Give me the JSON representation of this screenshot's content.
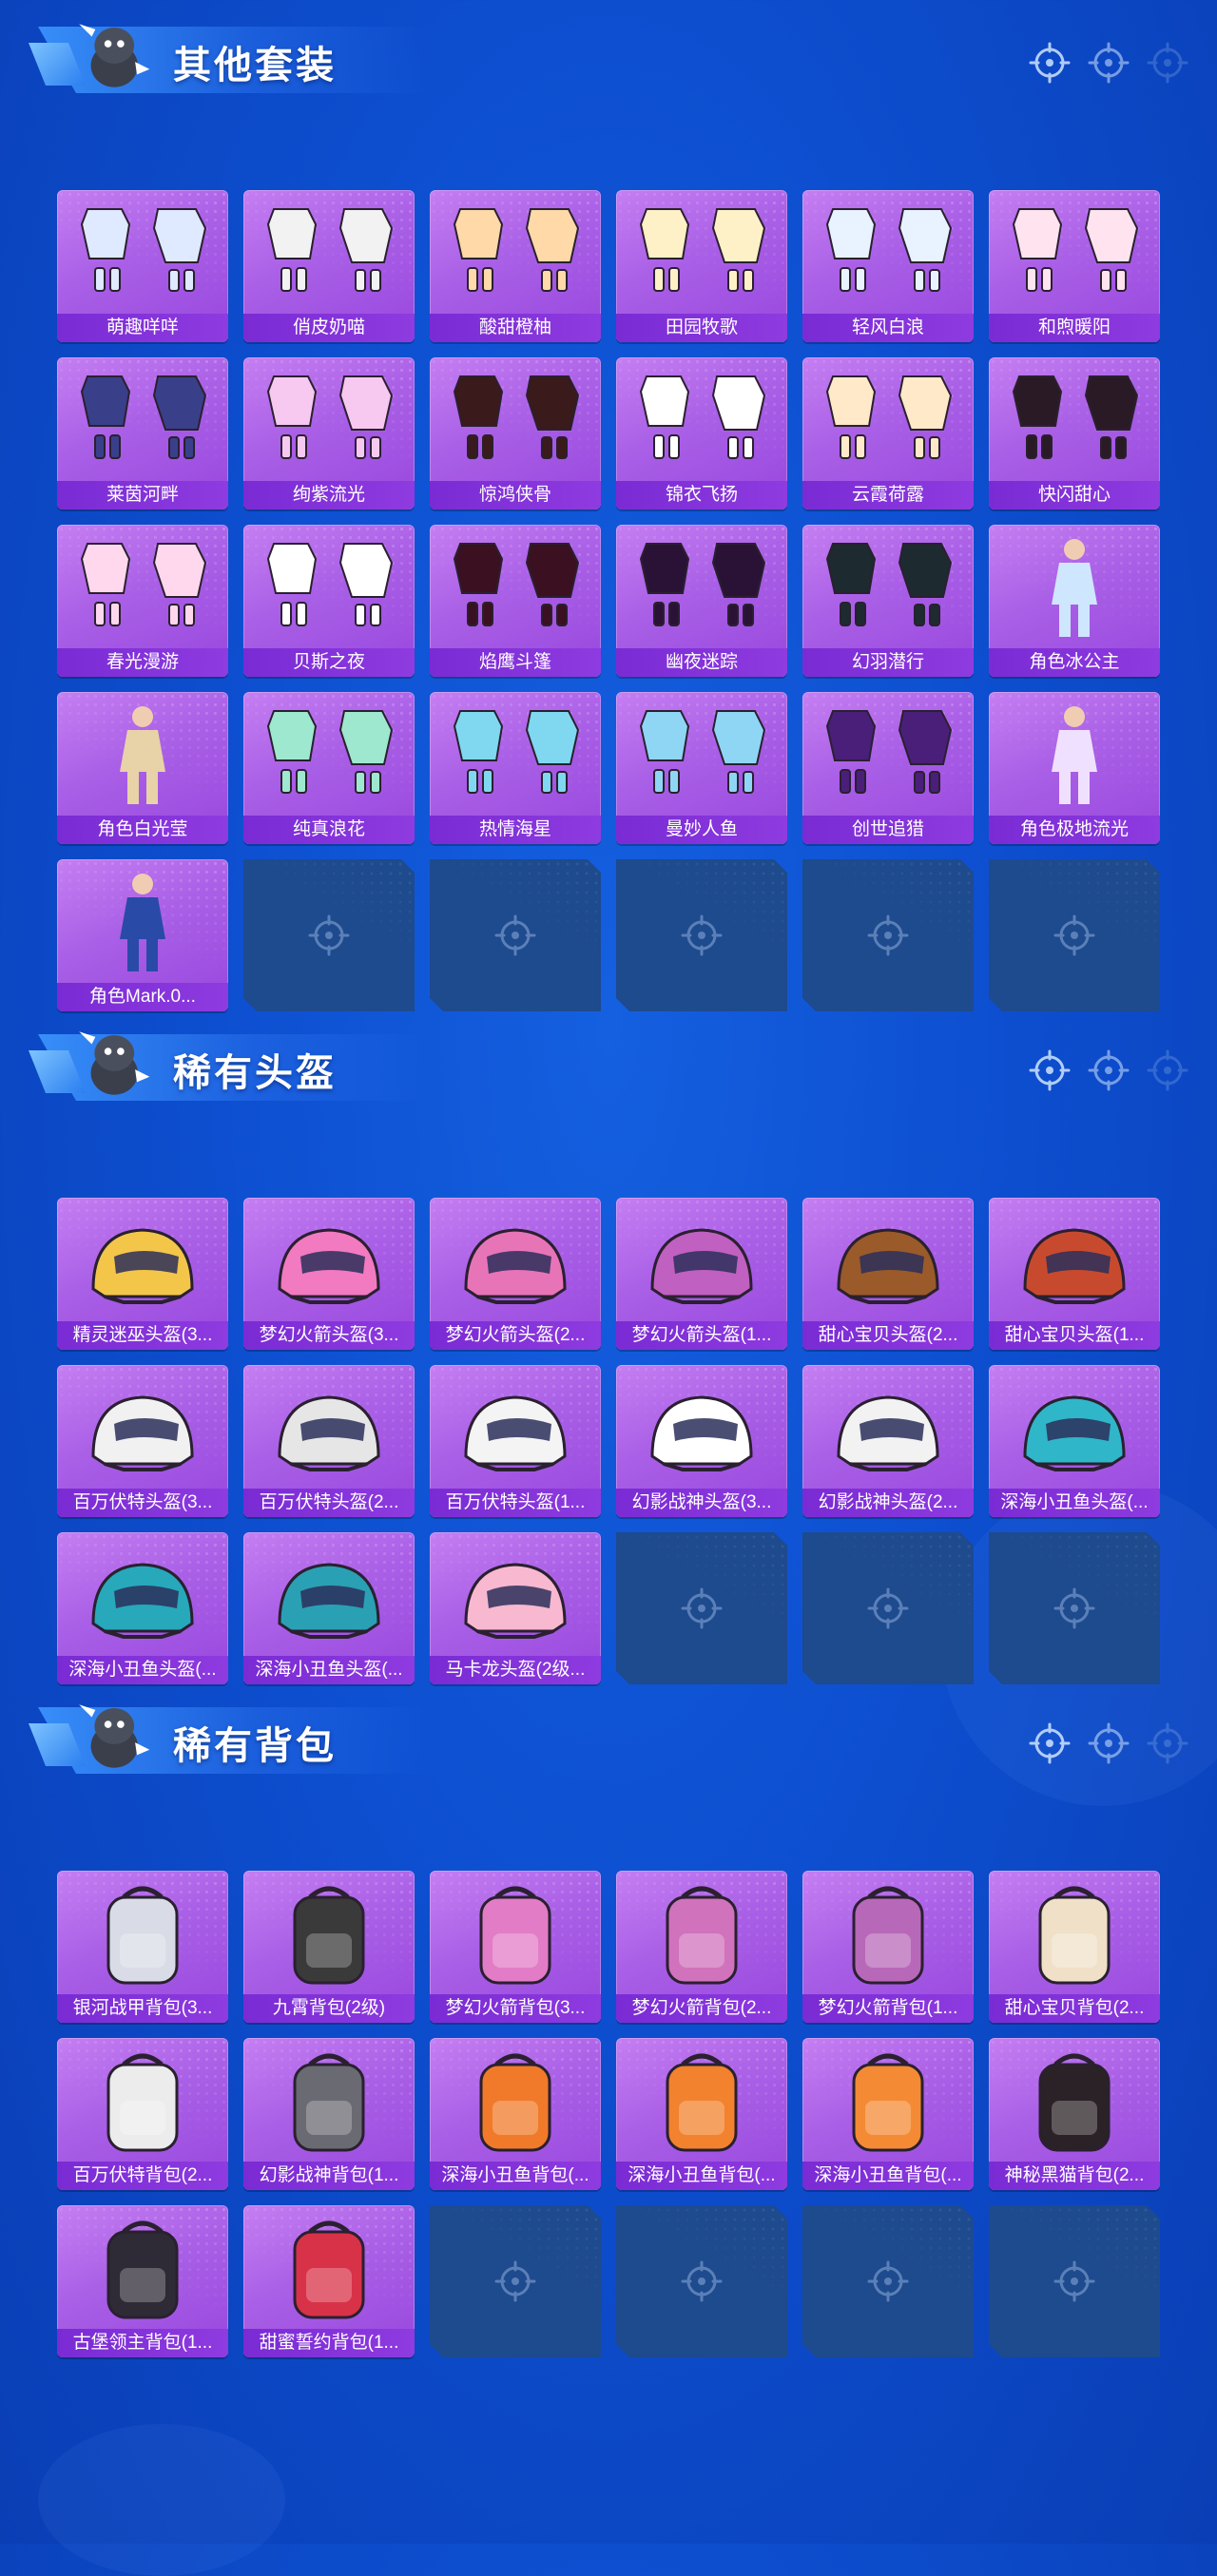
{
  "sections": [
    {
      "title": "其他套装",
      "items": [
        {
          "name": "萌趣咩咩",
          "icon": "outfit-icon",
          "tone": "#dfe9ff"
        },
        {
          "name": "俏皮奶喵",
          "icon": "outfit-icon",
          "tone": "#f2f2f2"
        },
        {
          "name": "酸甜橙柚",
          "icon": "outfit-icon",
          "tone": "#ffd9a8"
        },
        {
          "name": "田园牧歌",
          "icon": "outfit-icon",
          "tone": "#fff1c7"
        },
        {
          "name": "轻风白浪",
          "icon": "outfit-icon",
          "tone": "#e8f3ff"
        },
        {
          "name": "和煦暖阳",
          "icon": "outfit-icon",
          "tone": "#ffe3ef"
        },
        {
          "name": "莱茵河畔",
          "icon": "outfit-icon",
          "tone": "#3a3f8a"
        },
        {
          "name": "绚紫流光",
          "icon": "outfit-icon",
          "tone": "#f7c8f0"
        },
        {
          "name": "惊鸿侠骨",
          "icon": "outfit-icon",
          "tone": "#3a1a1a"
        },
        {
          "name": "锦衣飞扬",
          "icon": "outfit-icon",
          "tone": "#ffffff"
        },
        {
          "name": "云霞荷露",
          "icon": "outfit-icon",
          "tone": "#ffe9c9"
        },
        {
          "name": "快闪甜心",
          "icon": "outfit-icon",
          "tone": "#2a1a26"
        },
        {
          "name": "春光漫游",
          "icon": "outfit-icon",
          "tone": "#ffd8ee"
        },
        {
          "name": "贝斯之夜",
          "icon": "outfit-icon",
          "tone": "#ffffff"
        },
        {
          "name": "焰鹰斗篷",
          "icon": "outfit-icon",
          "tone": "#3b1020"
        },
        {
          "name": "幽夜迷踪",
          "icon": "outfit-icon",
          "tone": "#2a1236"
        },
        {
          "name": "幻羽潜行",
          "icon": "outfit-icon",
          "tone": "#1d2a30"
        },
        {
          "name": "角色冰公主",
          "icon": "character-icon",
          "tone": "#cfe6ff"
        },
        {
          "name": "角色白光莹",
          "icon": "character-icon",
          "tone": "#e8d2a8"
        },
        {
          "name": "纯真浪花",
          "icon": "outfit-icon",
          "tone": "#9fe8d0"
        },
        {
          "name": "热情海星",
          "icon": "outfit-icon",
          "tone": "#7fd8f0"
        },
        {
          "name": "曼妙人鱼",
          "icon": "outfit-icon",
          "tone": "#8fd6f5"
        },
        {
          "name": "创世追猎",
          "icon": "outfit-icon",
          "tone": "#4a1f7a"
        },
        {
          "name": "角色极地流光",
          "icon": "character-icon",
          "tone": "#f0e0ff"
        },
        {
          "name": "角色Mark.0...",
          "icon": "character-icon",
          "tone": "#2a4aa8"
        }
      ],
      "empty_slots": 5
    },
    {
      "title": "稀有头盔",
      "items": [
        {
          "name": "精灵迷巫头盔(3...",
          "icon": "helmet-icon",
          "tone": "#f3c64a"
        },
        {
          "name": "梦幻火箭头盔(3...",
          "icon": "helmet-icon",
          "tone": "#f27ac0"
        },
        {
          "name": "梦幻火箭头盔(2...",
          "icon": "helmet-icon",
          "tone": "#e874b8"
        },
        {
          "name": "梦幻火箭头盔(1...",
          "icon": "helmet-icon",
          "tone": "#c060c0"
        },
        {
          "name": "甜心宝贝头盔(2...",
          "icon": "helmet-icon",
          "tone": "#9a5a2a"
        },
        {
          "name": "甜心宝贝头盔(1...",
          "icon": "helmet-icon",
          "tone": "#c84a2e"
        },
        {
          "name": "百万伏特头盔(3...",
          "icon": "helmet-icon",
          "tone": "#f1f1f1"
        },
        {
          "name": "百万伏特头盔(2...",
          "icon": "helmet-icon",
          "tone": "#e6e6e6"
        },
        {
          "name": "百万伏特头盔(1...",
          "icon": "helmet-icon",
          "tone": "#f4f4f4"
        },
        {
          "name": "幻影战神头盔(3...",
          "icon": "helmet-icon",
          "tone": "#ffffff"
        },
        {
          "name": "幻影战神头盔(2...",
          "icon": "helmet-icon",
          "tone": "#f2f2f2"
        },
        {
          "name": "深海小丑鱼头盔(...",
          "icon": "helmet-icon",
          "tone": "#2fb6c8"
        },
        {
          "name": "深海小丑鱼头盔(...",
          "icon": "helmet-icon",
          "tone": "#27a8bb"
        },
        {
          "name": "深海小丑鱼头盔(...",
          "icon": "helmet-icon",
          "tone": "#2aa0b4"
        },
        {
          "name": "马卡龙头盔(2级...",
          "icon": "helmet-icon",
          "tone": "#f8b8d0"
        }
      ],
      "empty_slots": 3
    },
    {
      "title": "稀有背包",
      "items": [
        {
          "name": "银河战甲背包(3...",
          "icon": "backpack-icon",
          "tone": "#d9dce6"
        },
        {
          "name": "九霄背包(2级)",
          "icon": "backpack-icon",
          "tone": "#3a3a3a"
        },
        {
          "name": "梦幻火箭背包(3...",
          "icon": "backpack-icon",
          "tone": "#e27cc6"
        },
        {
          "name": "梦幻火箭背包(2...",
          "icon": "backpack-icon",
          "tone": "#d072bc"
        },
        {
          "name": "梦幻火箭背包(1...",
          "icon": "backpack-icon",
          "tone": "#b868b8"
        },
        {
          "name": "甜心宝贝背包(2...",
          "icon": "backpack-icon",
          "tone": "#f0e0c8"
        },
        {
          "name": "百万伏特背包(2...",
          "icon": "backpack-icon",
          "tone": "#ececec"
        },
        {
          "name": "幻影战神背包(1...",
          "icon": "backpack-icon",
          "tone": "#6a6a72"
        },
        {
          "name": "深海小丑鱼背包(...",
          "icon": "backpack-icon",
          "tone": "#f07a2a"
        },
        {
          "name": "深海小丑鱼背包(...",
          "icon": "backpack-icon",
          "tone": "#f2822e"
        },
        {
          "name": "深海小丑鱼背包(...",
          "icon": "backpack-icon",
          "tone": "#f48a34"
        },
        {
          "name": "神秘黑猫背包(2...",
          "icon": "backpack-icon",
          "tone": "#2a2226"
        },
        {
          "name": "古堡领主背包(1...",
          "icon": "backpack-icon",
          "tone": "#2e2a36"
        },
        {
          "name": "甜蜜誓约背包(1...",
          "icon": "backpack-icon",
          "tone": "#d83248"
        }
      ],
      "empty_slots": 4
    }
  ],
  "colors": {
    "card_top": "#c57ef2",
    "card_bottom": "#9847de",
    "label_bg": "#7a2bd4",
    "empty_slot": "#1e4a8e",
    "background": "#0d4fd0"
  }
}
